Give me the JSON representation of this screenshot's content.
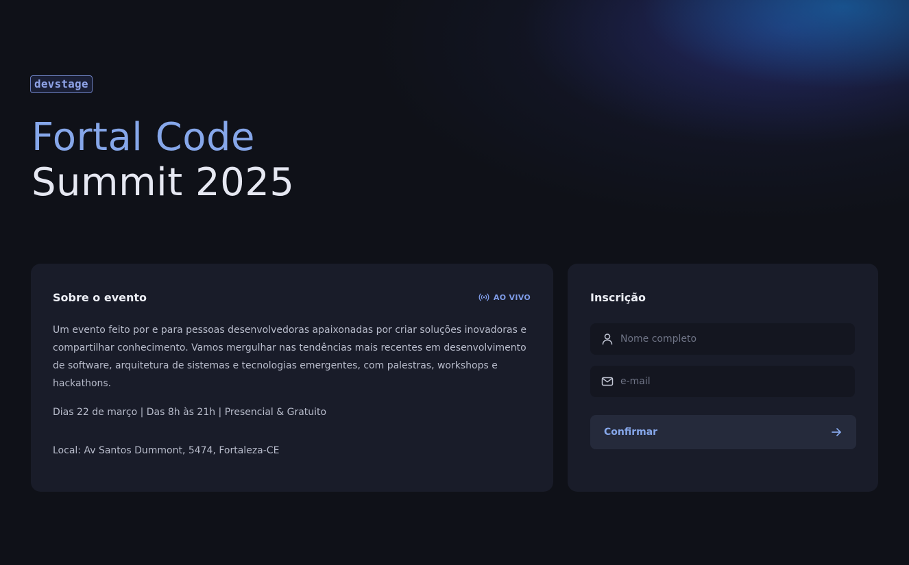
{
  "brand": {
    "logo_text": "devstage"
  },
  "hero": {
    "title_line1": "Fortal Code",
    "title_line2": "Summit 2025"
  },
  "about": {
    "title": "Sobre o evento",
    "live_label": "AO VIVO",
    "description": "Um evento feito por e para pessoas desenvolvedoras apaixonadas por criar soluções inovadoras e compartilhar conhecimento. Vamos mergulhar nas tendências mais recentes em desenvolvimento de software, arquitetura de sistemas e tecnologias emergentes, com palestras, workshops e hackathons.",
    "schedule": "Dias 22 de março | Das 8h às 21h | Presencial & Gratuito",
    "location": "Local: Av Santos Dummont, 5474, Fortaleza-CE"
  },
  "signup": {
    "title": "Inscrição",
    "name_field": {
      "placeholder": "Nome completo",
      "value": "",
      "icon": "user-icon"
    },
    "email_field": {
      "placeholder": "e-mail",
      "value": "",
      "icon": "mail-icon"
    },
    "confirm_label": "Confirmar",
    "confirm_icon": "arrow-right-icon"
  },
  "colors": {
    "background": "#0f1118",
    "card": "#191c29",
    "accent": "#86a7ea",
    "input": "#141620",
    "button": "#252a3b"
  }
}
